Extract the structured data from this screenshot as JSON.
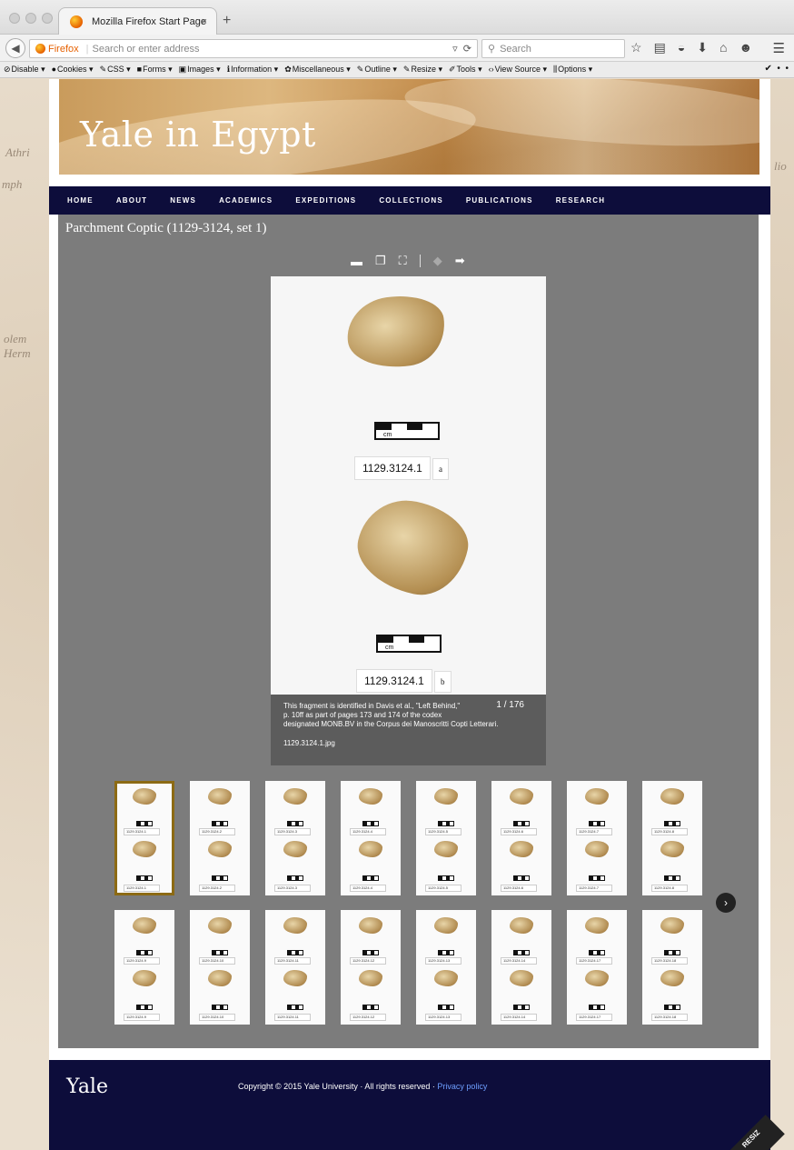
{
  "browser": {
    "tab_title": "Mozilla Firefox Start Page",
    "tab_close": "×",
    "new_tab": "+",
    "url_badge": "Firefox",
    "url_placeholder": "Search or enter address",
    "search_placeholder": "Search",
    "devbar": [
      "Disable",
      "Cookies",
      "CSS",
      "Forms",
      "Images",
      "Information",
      "Miscellaneous",
      "Outline",
      "Resize",
      "Tools",
      "View Source",
      "Options"
    ]
  },
  "site": {
    "title": "Yale in Egypt",
    "nav": [
      "HOME",
      "ABOUT",
      "NEWS",
      "ACADEMICS",
      "EXPEDITIONS",
      "COLLECTIONS",
      "PUBLICATIONS",
      "RESEARCH"
    ]
  },
  "gallery": {
    "title": "Parchment Coptic (1129-3124, set 1)",
    "counter": "1 / 176",
    "caption_lines": [
      "This fragment is identified in Davis et al., \"Left Behind,\"",
      "p. 10ff as part of pages 173 and 174 of the codex",
      "designated MONB.BV in the Corpus dei Manoscritti Copti Letterari."
    ],
    "filename": "1129.3124.1.jpg",
    "main_image": {
      "label_top": "1129.3124.1",
      "side_top": "a",
      "label_bottom": "1129.3124.1",
      "side_bottom": "b",
      "scale_unit": "cm"
    },
    "thumbnails": [
      "1129.3124.1",
      "1129.3124.2",
      "1129.3124.3",
      "1129.3124.4",
      "1129.3124.5",
      "1129.3124.6",
      "1129.3124.7",
      "1129.3124.8",
      "1129.3124.9",
      "1129.3124.10",
      "1129.3124.11",
      "1129.3124.12",
      "1129.3124.13",
      "1129.3124.14",
      "1129.3124.17",
      "1129.3124.18"
    ]
  },
  "footer": {
    "logo": "Yale",
    "copyright": "Copyright © 2015 Yale University · All rights reserved · ",
    "privacy": "Privacy policy"
  },
  "colors": {
    "nav_bg": "#0d0d3b",
    "gallery_bg": "#7c7c7c",
    "active_thumb": "#8c6a14",
    "link": "#6e9fff"
  }
}
